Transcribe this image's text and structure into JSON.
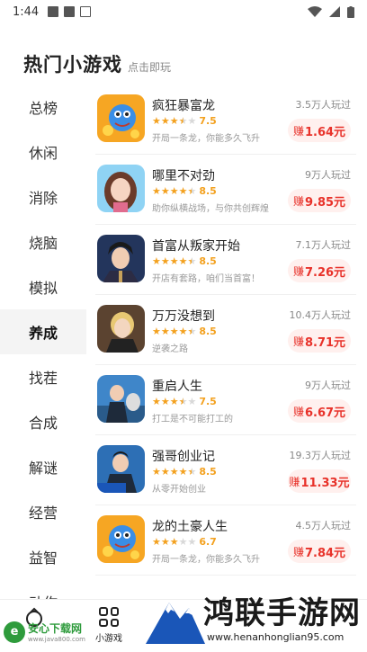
{
  "status": {
    "time": "1:44"
  },
  "header": {
    "title": "热门小游戏",
    "subtitle": "点击即玩"
  },
  "sidebar": {
    "items": [
      {
        "label": "总榜"
      },
      {
        "label": "休闲"
      },
      {
        "label": "消除"
      },
      {
        "label": "烧脑"
      },
      {
        "label": "模拟"
      },
      {
        "label": "养成"
      },
      {
        "label": "找茬"
      },
      {
        "label": "合成"
      },
      {
        "label": "解谜"
      },
      {
        "label": "经营"
      },
      {
        "label": "益智"
      },
      {
        "label": "动作"
      }
    ],
    "active": "养成"
  },
  "games": [
    {
      "name": "疯狂暴富龙",
      "rating": 3.5,
      "score": "7.5",
      "desc": "开局一条龙，你能多久飞升",
      "plays": "3.5万人玩过",
      "earn_prefix": "赚",
      "earn": "1.64元",
      "thumb": "dragon"
    },
    {
      "name": "哪里不对劲",
      "rating": 4.5,
      "score": "8.5",
      "desc": "助你纵横战场，与你共创辉煌",
      "plays": "9万人玩过",
      "earn_prefix": "赚",
      "earn": "9.85元",
      "thumb": "girl"
    },
    {
      "name": "首富从叛家开始",
      "rating": 4.5,
      "score": "8.5",
      "desc": "开店有套路，咱们当首富！",
      "plays": "7.1万人玩过",
      "earn_prefix": "赚",
      "earn": "7.26元",
      "thumb": "man"
    },
    {
      "name": "万万没想到",
      "rating": 4.5,
      "score": "8.5",
      "desc": "逆袭之路",
      "plays": "10.4万人玩过",
      "earn_prefix": "赚",
      "earn": "8.71元",
      "thumb": "blond"
    },
    {
      "name": "重启人生",
      "rating": 3.5,
      "score": "7.5",
      "desc": "打工是不可能打工的",
      "plays": "9万人玩过",
      "earn_prefix": "赚",
      "earn": "6.67元",
      "thumb": "suit"
    },
    {
      "name": "强哥创业记",
      "rating": 4.5,
      "score": "8.5",
      "desc": "从零开始创业",
      "plays": "19.3万人玩过",
      "earn_prefix": "赚",
      "earn": "11.33元",
      "thumb": "boss"
    },
    {
      "name": "龙的土豪人生",
      "rating": 3,
      "score": "6.7",
      "desc": "开局一条龙，你能多久飞升",
      "plays": "4.5万人玩过",
      "earn_prefix": "赚",
      "earn": "7.84元",
      "thumb": "dragon"
    }
  ],
  "bottom_nav": {
    "games_label": "小游戏"
  },
  "watermarks": {
    "left_title": "安心下载网",
    "left_url": "www.java800.com",
    "right_title": "鸿联手游网",
    "right_url": "www.henanhonglian95.com"
  },
  "colors": {
    "accent_red": "#e8322a",
    "star": "#f3a11f",
    "earn_bg": "#fff0ee"
  }
}
